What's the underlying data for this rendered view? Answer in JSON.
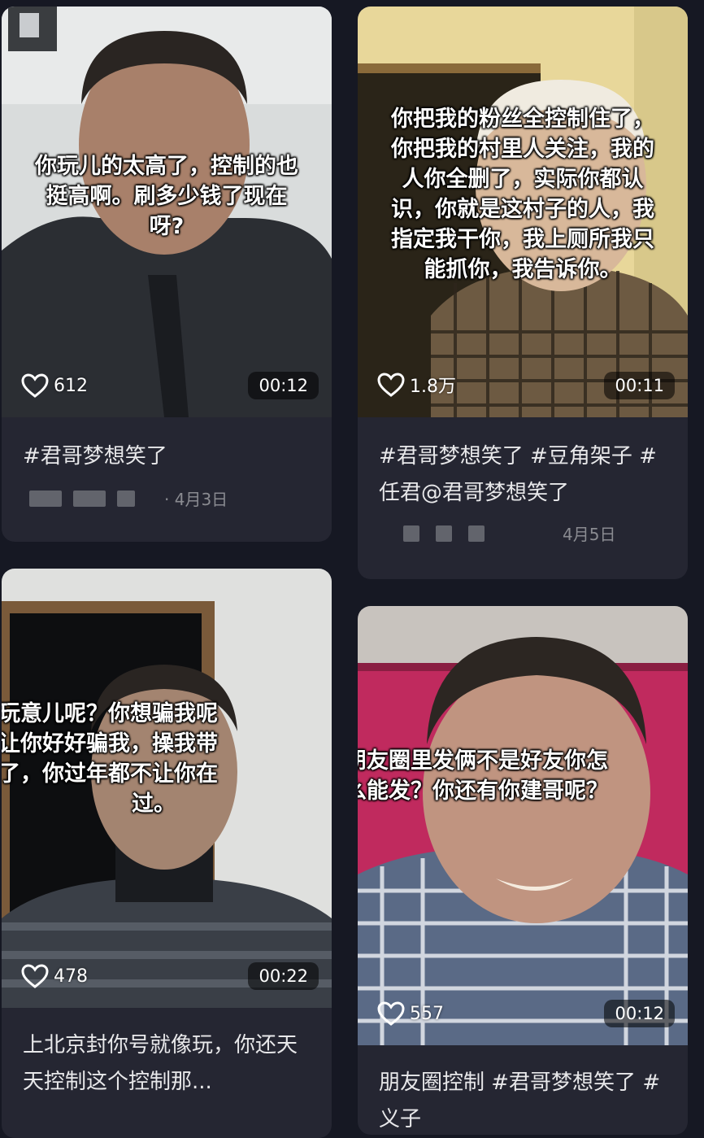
{
  "cards": [
    {
      "overlay_lines": [
        "你玩儿的太高了，控制的也",
        "挺高啊。刷多少钱了现在",
        "呀?"
      ],
      "likes": "612",
      "duration": "00:12",
      "description": "#君哥梦想笑了",
      "date": "· 4月3日"
    },
    {
      "overlay_lines": [
        "你把我的粉丝全控制住了，",
        "你把我的村里人关注，我的",
        "人你全删了，实际你都认",
        "识，你就是这村子的人，我",
        "指定我干你，我上厕所我只",
        "能抓你，我告诉你。"
      ],
      "likes": "1.8万",
      "duration": "00:11",
      "description": "#君哥梦想笑了 #豆角架子 #任君@君哥梦想笑了",
      "date": "4月5日"
    },
    {
      "overlay_lines": [
        "玩意儿呢？你想骗我呢",
        "让你好好骗我，操我带",
        "了，你过年都不让你在",
        "过。"
      ],
      "likes": "478",
      "duration": "00:22",
      "description": "上北京封你号就像玩，你还天天控制这个控制那..."
    },
    {
      "overlay_lines": [
        "朋友圈里发俩不是好友你怎",
        "么能发？你还有你建哥呢？"
      ],
      "likes": "557",
      "duration": "00:12",
      "description": "朋友圈控制 #君哥梦想笑了 #义子"
    }
  ]
}
